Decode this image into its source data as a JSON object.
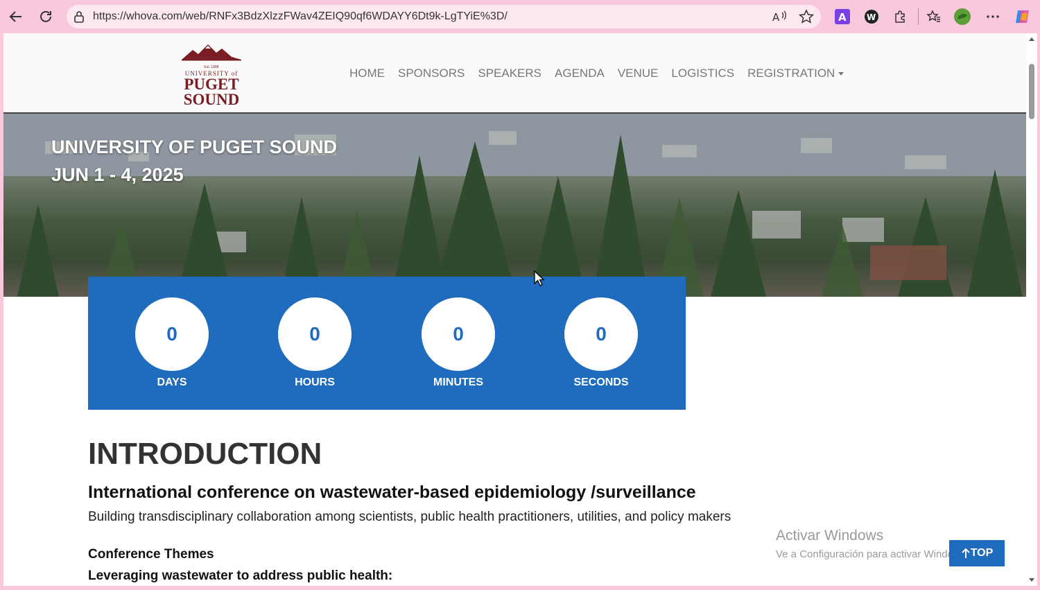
{
  "browser": {
    "url": "https://whova.com/web/RNFx3BdzXlzzFWav4ZEIQ90qf6WDAYY6Dt9k-LgTYiE%3D/",
    "icons": [
      "back-icon",
      "reload-icon",
      "lock-icon",
      "read-aloud-icon",
      "favorite-star-icon",
      "extension-a-icon",
      "extension-w-icon",
      "extensions-puzzle-icon",
      "favorites-icon",
      "profile-icon",
      "more-icon",
      "copilot-icon"
    ]
  },
  "logo": {
    "est": "Est. 1888",
    "university": "UNIVERSITY of",
    "puget": "PUGET",
    "sound": "SOUND",
    "color": "#7b1e23"
  },
  "nav": {
    "home": "HOME",
    "sponsors": "SPONSORS",
    "speakers": "SPEAKERS",
    "agenda": "AGENDA",
    "venue": "VENUE",
    "logistics": "LOGISTICS",
    "registration": "REGISTRATION"
  },
  "hero": {
    "title_line1": "UNIVERSITY OF PUGET SOUND",
    "title_line2": "JUN 1 - 4, 2025"
  },
  "countdown": {
    "days_value": "0",
    "days_label": "DAYS",
    "hours_value": "0",
    "hours_label": "HOURS",
    "minutes_value": "0",
    "minutes_label": "MINUTES",
    "seconds_value": "0",
    "seconds_label": "SECONDS",
    "color": "#1f6bbd"
  },
  "intro": {
    "heading": "INTRODUCTION",
    "subtitle": "International conference on wastewater-based epidemiology /surveillance",
    "description": "Building transdisciplinary collaboration among scientists, public health practitioners, utilities, and policy makers",
    "themes_heading": "Conference Themes",
    "themes_sub": "Leveraging wastewater to address public health:"
  },
  "top_button": "TOP",
  "watermark": {
    "line1": "Activar Windows",
    "line2": "Ve a Configuración para activar Windows."
  }
}
